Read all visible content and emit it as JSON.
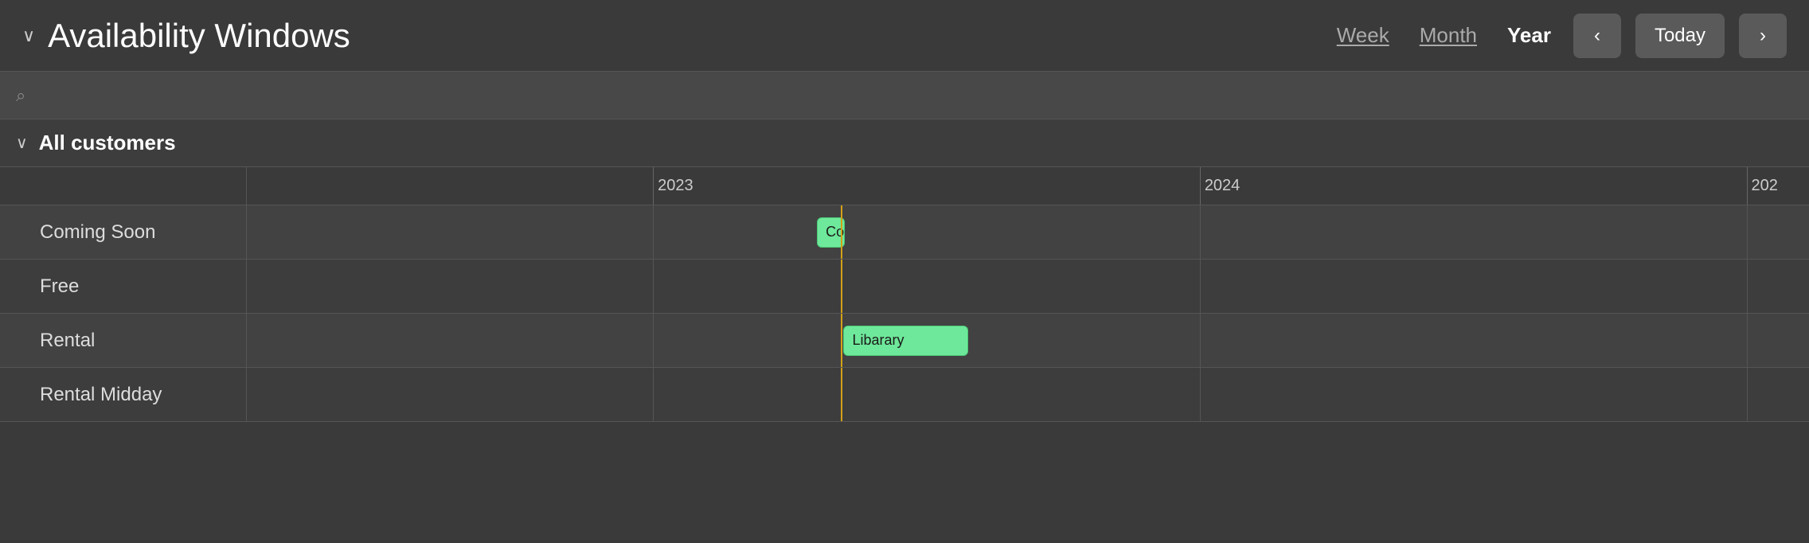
{
  "header": {
    "chevron": "∨",
    "title": "Availability Windows",
    "views": [
      {
        "label": "Week",
        "id": "week",
        "active": false
      },
      {
        "label": "Month",
        "id": "month",
        "active": false
      },
      {
        "label": "Year",
        "id": "year",
        "active": true
      }
    ],
    "prev_label": "‹",
    "today_label": "Today",
    "next_label": "›"
  },
  "search": {
    "placeholder": "",
    "icon": "⌕"
  },
  "group": {
    "chevron": "∨",
    "label": "All customers"
  },
  "timeline": {
    "years": [
      {
        "label": "2023",
        "left_pct": 26.0
      },
      {
        "label": "2024",
        "left_pct": 61.0
      },
      {
        "label": "202",
        "left_pct": 96.0
      }
    ],
    "today_left_pct": 38.0,
    "rows": [
      {
        "label": "Coming Soon",
        "bar": {
          "left_pct": 36.5,
          "width_pct": 1.8,
          "text": "Co"
        }
      },
      {
        "label": "Free",
        "bar": null
      },
      {
        "label": "Rental",
        "bar": {
          "left_pct": 38.2,
          "width_pct": 8.0,
          "text": "Libarary"
        }
      },
      {
        "label": "Rental Midday",
        "bar": null
      }
    ]
  }
}
